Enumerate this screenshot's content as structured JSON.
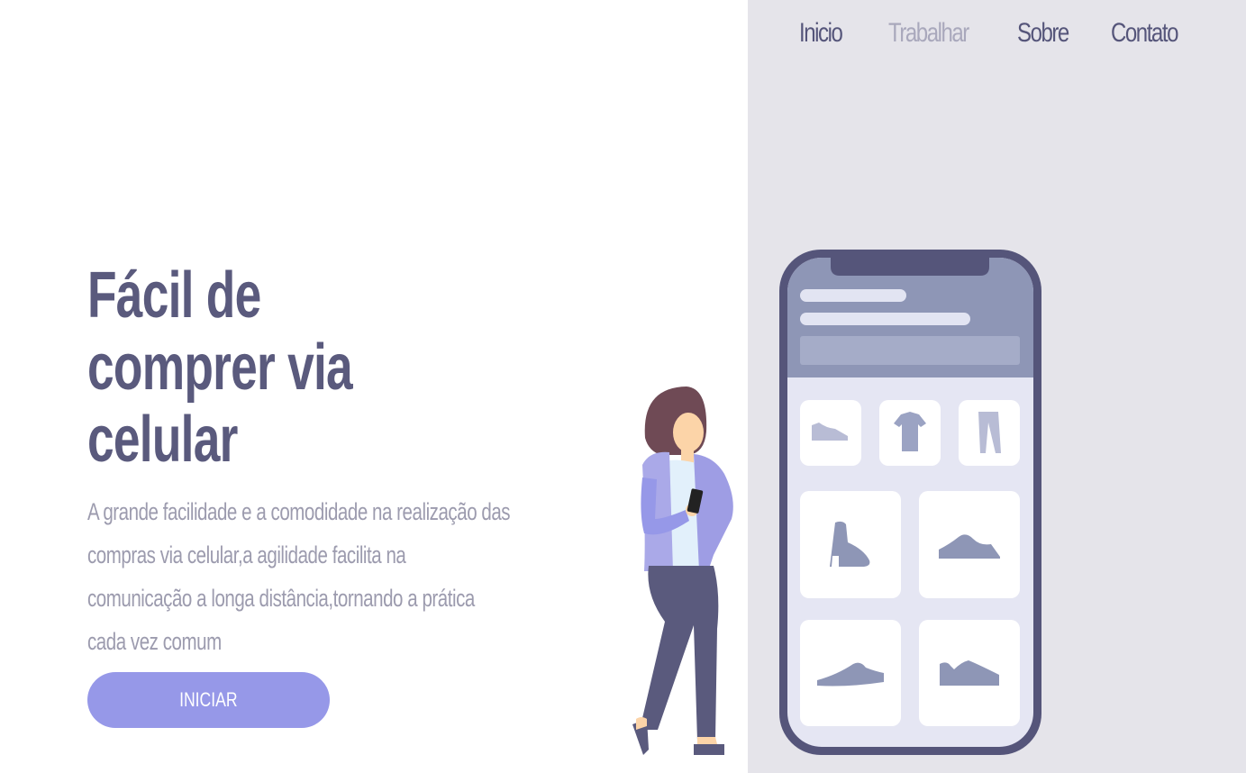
{
  "nav": {
    "items": [
      {
        "label": "Inicio",
        "active": false
      },
      {
        "label": "Trabalhar",
        "active": true
      },
      {
        "label": "Sobre",
        "active": false
      },
      {
        "label": "Contato",
        "active": false
      }
    ]
  },
  "hero": {
    "title_lines": [
      "Fácil de",
      "comprer via",
      "celular"
    ],
    "description_lines": [
      "A grande facilidade e a comodidade na realização das",
      "compras via celular,a agilidade facilita na",
      "comunicação a longa distância,tornando a prática",
      "cada vez comum"
    ],
    "cta_label": "INICIAR"
  },
  "illustration": {
    "phone_products": [
      "sneaker-icon",
      "tshirt-icon",
      "pants-icon",
      "boot-icon",
      "sneaker-icon",
      "shoe-icon",
      "sneaker-icon"
    ]
  },
  "colors": {
    "accent": "#9698e8",
    "text_dark": "#5a5a7d",
    "text_muted": "#9c9bae",
    "panel_bg": "#e5e4ea",
    "phone_frame": "#55557a"
  }
}
